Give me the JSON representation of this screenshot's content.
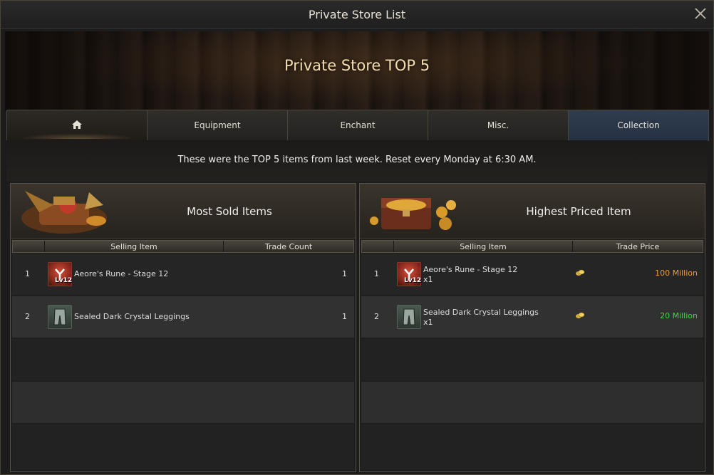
{
  "window": {
    "title": "Private Store List"
  },
  "hero": {
    "title": "Private Store TOP 5"
  },
  "tabs": [
    {
      "label": "",
      "icon": "home-icon"
    },
    {
      "label": "Equipment"
    },
    {
      "label": "Enchant"
    },
    {
      "label": "Misc."
    },
    {
      "label": "Collection"
    }
  ],
  "notice": "These were the TOP 5 items from last week. Reset every Monday at 6:30 AM.",
  "most_sold": {
    "title": "Most Sold Items",
    "columns": {
      "item": "Selling Item",
      "count": "Trade Count"
    },
    "rows": [
      {
        "rank": "1",
        "name": "Aeore's Rune - Stage 12",
        "level": "Lv12",
        "count": "1",
        "icon": "rune-icon"
      },
      {
        "rank": "2",
        "name": "Sealed Dark Crystal Leggings",
        "count": "1",
        "icon": "leggings-icon"
      }
    ]
  },
  "highest_priced": {
    "title": "Highest Priced Item",
    "columns": {
      "item": "Selling Item",
      "price": "Trade Price"
    },
    "rows": [
      {
        "rank": "1",
        "name": "Aeore's Rune - Stage 12",
        "level": "Lv12",
        "qty": "x1",
        "price": "100 Million",
        "price_color": "#f0a030",
        "icon": "rune-icon"
      },
      {
        "rank": "2",
        "name": "Sealed Dark Crystal Leggings",
        "qty": "x1",
        "price": "20 Million",
        "price_color": "#40d840",
        "icon": "leggings-icon"
      }
    ]
  }
}
